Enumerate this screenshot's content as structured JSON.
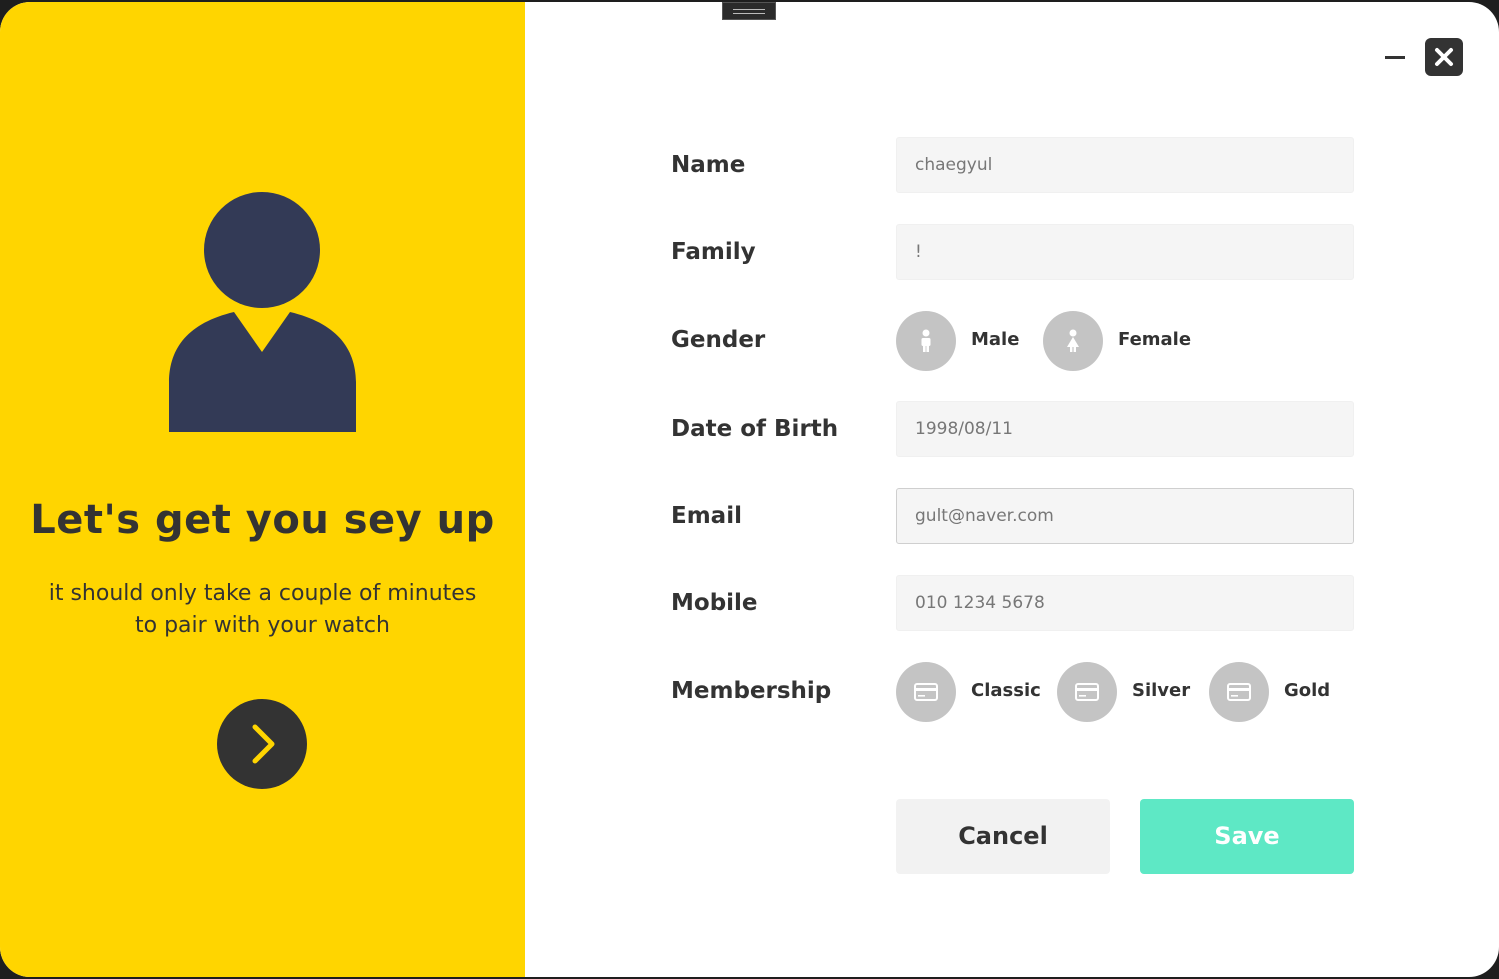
{
  "colors": {
    "panel": "#FFD500",
    "accent": "#5EE8C5",
    "dark": "#333333",
    "avatar": "#333A56",
    "option_circle": "#C4C4C4",
    "field_bg": "#F5F5F5"
  },
  "left": {
    "headline": "Let's get you sey up",
    "subline_1": "it should only take a couple of minutes",
    "subline_2": "to pair with your watch",
    "avatar_icon": "user-silhouette",
    "next_icon": "chevron-right"
  },
  "window_controls": {
    "minimize_icon": "minus",
    "close_icon": "x-mark"
  },
  "form": {
    "name": {
      "label": "Name",
      "value": "chaegyul"
    },
    "family": {
      "label": "Family",
      "value": "!"
    },
    "gender": {
      "label": "Gender",
      "options": [
        {
          "label": "Male",
          "icon": "male-person"
        },
        {
          "label": "Female",
          "icon": "female-person"
        }
      ]
    },
    "dob": {
      "label": "Date of Birth",
      "value": "1998/08/11"
    },
    "email": {
      "label": "Email",
      "value": "gult@naver.com"
    },
    "mobile": {
      "label": "Mobile",
      "value": "010 1234 5678"
    },
    "membership": {
      "label": "Membership",
      "options": [
        {
          "label": "Classic",
          "icon": "credit-card"
        },
        {
          "label": "Silver",
          "icon": "credit-card"
        },
        {
          "label": "Gold",
          "icon": "credit-card"
        }
      ]
    }
  },
  "buttons": {
    "cancel": "Cancel",
    "save": "Save"
  }
}
